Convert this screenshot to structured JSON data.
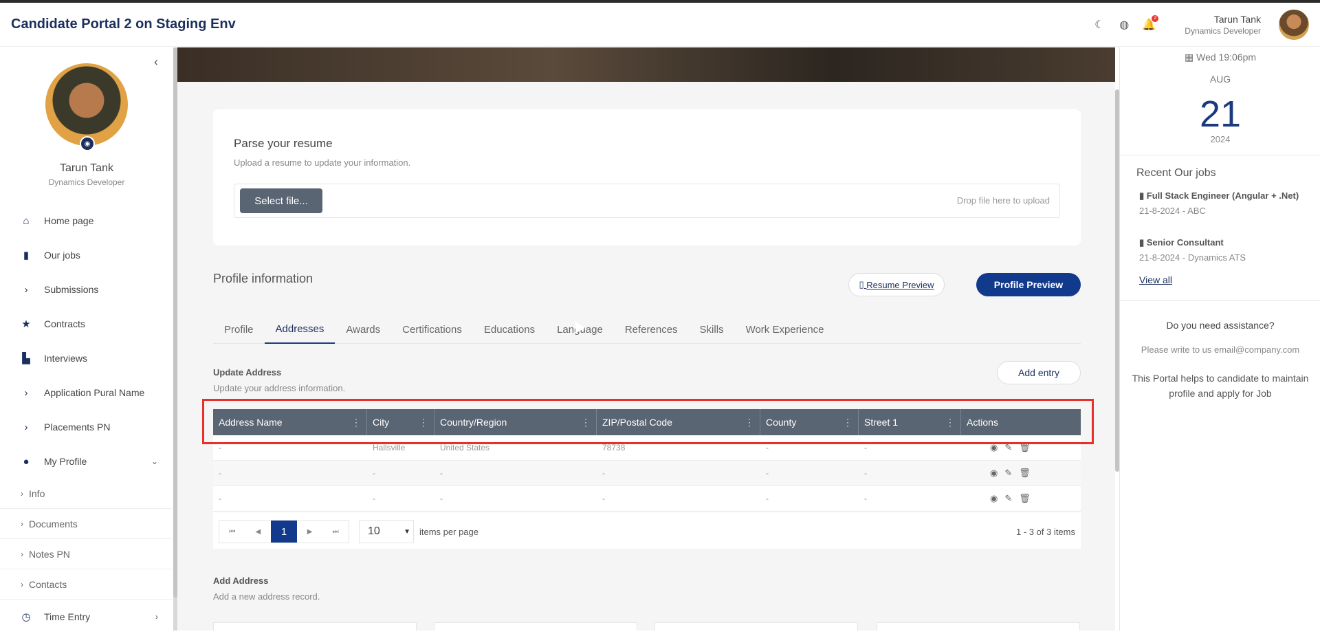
{
  "app_title": "Candidate Portal 2 on Staging Env",
  "topbar": {
    "icons": [
      "moon-icon",
      "globe-icon",
      "bell-icon"
    ],
    "notification_count": "2",
    "user_name": "Tarun Tank",
    "user_role": "Dynamics Developer"
  },
  "sidebar": {
    "collapse_icon": "‹",
    "user_name": "Tarun Tank",
    "user_role": "Dynamics Developer",
    "nav": [
      {
        "label": "Home page",
        "icon": "home-icon"
      },
      {
        "label": "Our jobs",
        "icon": "briefcase-icon"
      },
      {
        "label": "Submissions",
        "icon": "chevron-right-icon"
      },
      {
        "label": "Contracts",
        "icon": "star-icon"
      },
      {
        "label": "Interviews",
        "icon": "chart-icon"
      },
      {
        "label": "Application Pural Name",
        "icon": "chevron-right-icon"
      },
      {
        "label": "Placements PN",
        "icon": "chevron-right-icon"
      },
      {
        "label": "My Profile",
        "icon": "user-icon"
      }
    ],
    "sub": [
      "Info",
      "Documents",
      "Notes PN",
      "Contacts"
    ],
    "time_entry": "Time Entry"
  },
  "parse": {
    "title": "Parse your resume",
    "subtitle": "Upload a resume to update your information.",
    "select_label": "Select file...",
    "drop_text": "Drop file here to upload"
  },
  "profile_info": {
    "title": "Profile information",
    "resume_preview": "Resume Preview",
    "profile_preview": "Profile Preview"
  },
  "tabs": [
    "Profile",
    "Addresses",
    "Awards",
    "Certifications",
    "Educations",
    "Language",
    "References",
    "Skills",
    "Work Experience"
  ],
  "active_tab": "Addresses",
  "update": {
    "title": "Update Address",
    "subtitle": "Update your address information.",
    "add_entry": "Add entry"
  },
  "grid": {
    "columns": [
      "Address Name",
      "City",
      "Country/Region",
      "ZIP/Postal Code",
      "County",
      "Street 1",
      "Actions"
    ],
    "rows": [
      [
        "-",
        "Hallsville",
        "United States",
        "78738",
        "-",
        "-"
      ],
      [
        "-",
        "-",
        "-",
        "-",
        "-",
        "-"
      ],
      [
        "-",
        "-",
        "-",
        "-",
        "-",
        "-"
      ]
    ],
    "current_page": "1",
    "page_size": "10",
    "items_per_page": "items per page",
    "info": "1 - 3 of 3 items"
  },
  "add_address": {
    "title": "Add Address",
    "subtitle": "Add a new address record."
  },
  "right_panel": {
    "date_line": "Wed 19:06pm",
    "month": "AUG",
    "day": "21",
    "year": "2024",
    "jobs_title": "Recent Our jobs",
    "jobs": [
      {
        "title": "Full Stack Engineer (Angular + .Net)",
        "meta": "21-8-2024 - ABC"
      },
      {
        "title": "Senior Consultant",
        "meta": "21-8-2024 - Dynamics ATS"
      }
    ],
    "view_all": "View all",
    "assist_title": "Do you need assistance?",
    "assist_mail": "Please write to us email@company.com",
    "assist_text": "This Portal helps to candidate to maintain profile and apply for Job"
  },
  "colors": {
    "brand": "#1b2f5c",
    "primary_button": "#113a8c",
    "grid_header": "#5a6573",
    "highlight": "#e8302b"
  }
}
